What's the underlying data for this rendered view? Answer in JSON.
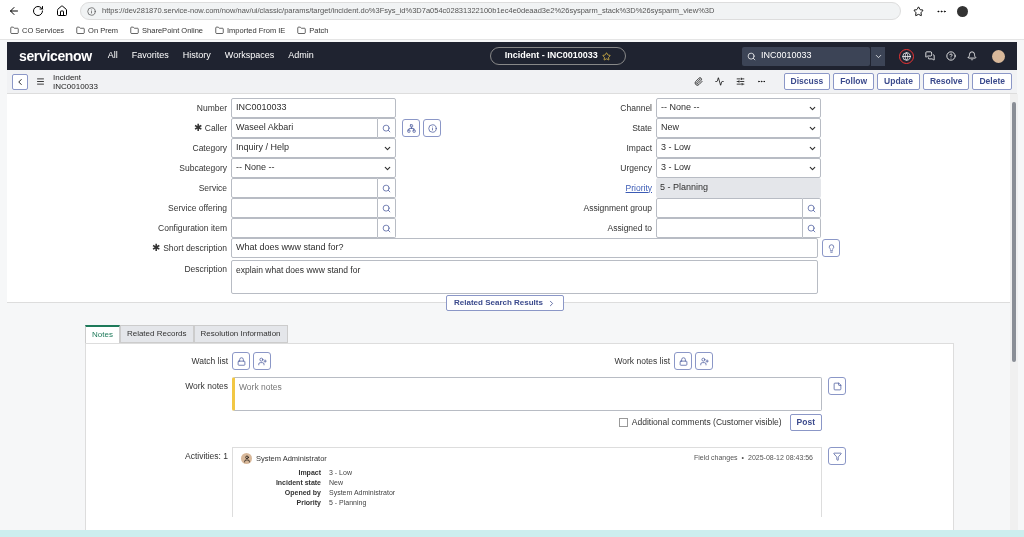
{
  "browser": {
    "url": "https://dev281870.service-now.com/now/nav/ui/classic/params/target/incident.do%3Fsys_id%3D7a054c02831322100b1ec4e0deaad3e2%26sysparm_stack%3D%26sysparm_view%3D",
    "bookmarks": [
      "CO Services",
      "On Prem",
      "SharePoint Online",
      "Imported From IE",
      "Patch"
    ]
  },
  "header": {
    "logo": "servicenow",
    "nav": [
      "All",
      "Favorites",
      "History",
      "Workspaces",
      "Admin"
    ],
    "record_pill": "Incident - INC0010033",
    "search_value": "INC0010033"
  },
  "record_bar": {
    "table": "Incident",
    "number": "INC0010033",
    "buttons": [
      "Discuss",
      "Follow",
      "Update",
      "Resolve",
      "Delete"
    ]
  },
  "form": {
    "left": [
      {
        "label": "Number",
        "kind": "text",
        "value": "INC0010033"
      },
      {
        "label": "Caller",
        "kind": "lookup_with_actions",
        "value": "Waseel Akbari",
        "required_mark": "✱"
      },
      {
        "label": "Category",
        "kind": "select",
        "value": "Inquiry / Help"
      },
      {
        "label": "Subcategory",
        "kind": "select",
        "value": "-- None --"
      },
      {
        "label": "Service",
        "kind": "lookup"
      },
      {
        "label": "Service offering",
        "kind": "lookup"
      },
      {
        "label": "Configuration item",
        "kind": "lookup"
      }
    ],
    "right": [
      {
        "label": "Channel",
        "kind": "select",
        "value": "-- None --"
      },
      {
        "label": "State",
        "kind": "select",
        "value": "New"
      },
      {
        "label": "Impact",
        "kind": "select",
        "value": "3 - Low"
      },
      {
        "label": "Urgency",
        "kind": "select",
        "value": "3 - Low"
      },
      {
        "label": "Priority",
        "kind": "readonly",
        "value": "5 - Planning"
      },
      {
        "label": "Assignment group",
        "kind": "lookup"
      },
      {
        "label": "Assigned to",
        "kind": "lookup"
      }
    ],
    "short_description": {
      "label": "Short description",
      "value": "What does www stand for?",
      "required_mark": "✱"
    },
    "description": {
      "label": "Description",
      "value": "explain what does www stand for"
    }
  },
  "related_button": "Related Search Results",
  "tabs": [
    {
      "label": "Notes",
      "selected": true
    },
    {
      "label": "Related Records",
      "selected": false
    },
    {
      "label": "Resolution Information",
      "selected": false
    }
  ],
  "notes": {
    "watch_list": "Watch list",
    "work_notes_list": "Work notes list",
    "work_notes_label": "Work notes",
    "work_notes_placeholder": "Work notes",
    "additional_comments": {
      "label": "Additional comments (Customer visible)",
      "checked": false
    },
    "post": "Post",
    "activities_label": "Activities: 1",
    "activity": {
      "author": "System Administrator",
      "type": "Field changes",
      "separator": "•",
      "time": "2025-08-12 08:43:56",
      "changes": [
        {
          "field": "Impact",
          "value": "3 - Low"
        },
        {
          "field": "Incident state",
          "value": "New"
        },
        {
          "field": "Opened by",
          "value": "System Administrator"
        },
        {
          "field": "Priority",
          "value": "5 - Planning"
        }
      ]
    }
  }
}
